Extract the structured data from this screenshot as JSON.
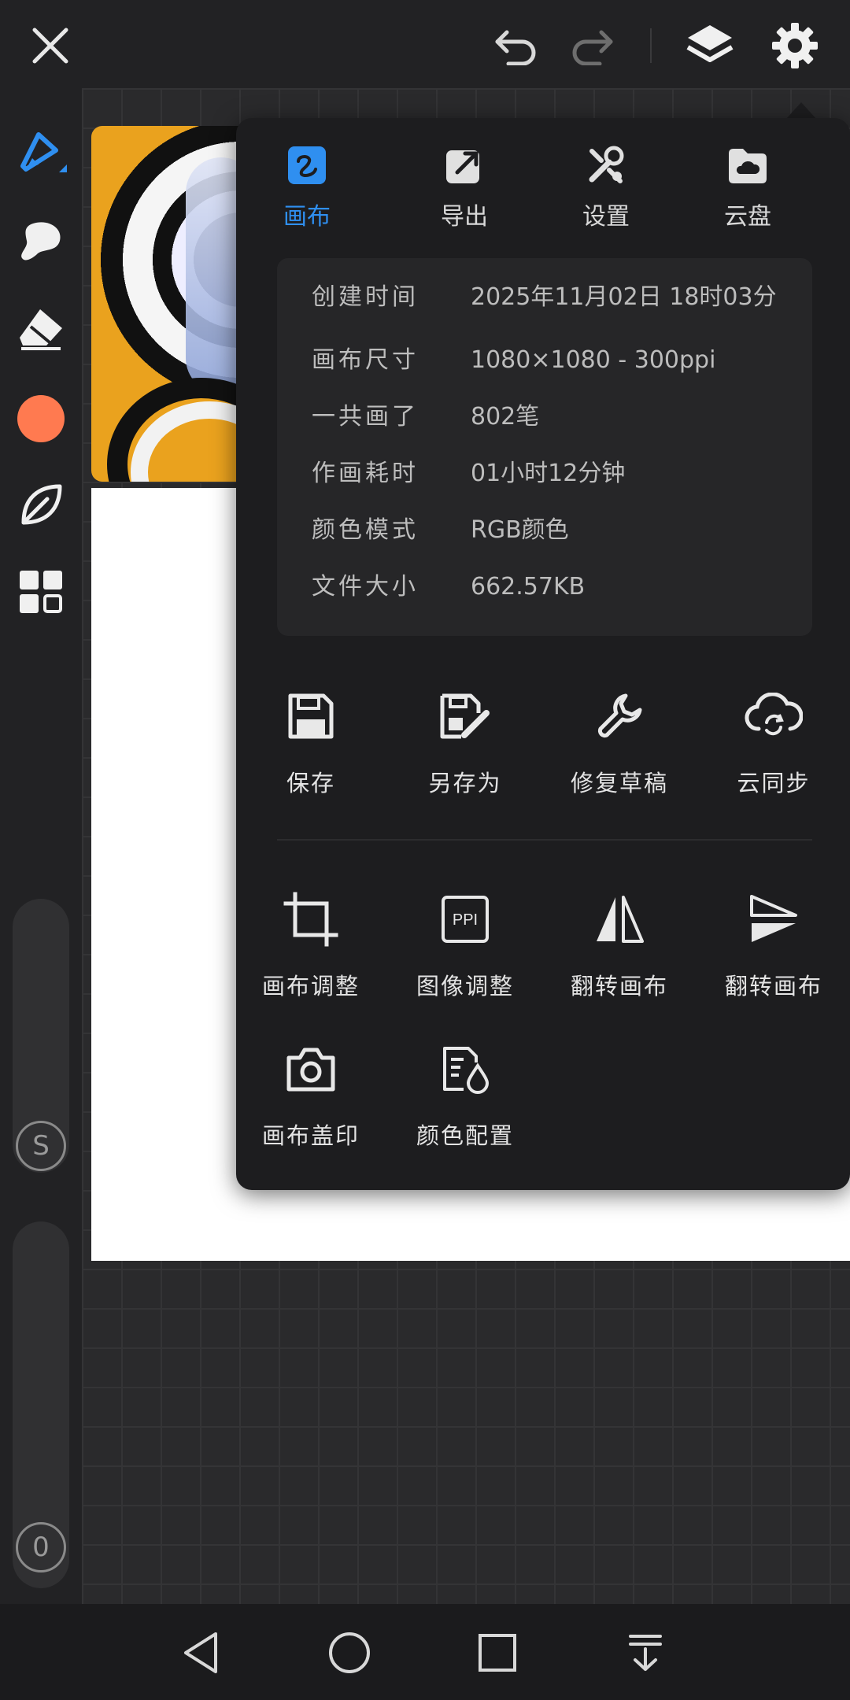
{
  "topbar": {
    "close_icon": "close-icon",
    "undo_icon": "undo-icon",
    "redo_icon": "redo-icon",
    "layers_icon": "layers-icon",
    "settings_icon": "gear-icon"
  },
  "sidebar": {
    "tools": [
      "pen-icon",
      "smudge-icon",
      "eraser-icon",
      "color-swatch",
      "leaf-icon",
      "grid-icon"
    ],
    "current_color": "#ff7a50",
    "size_slider_label": "S",
    "opacity_slider_label": "0"
  },
  "panel": {
    "tabs": [
      {
        "label": "画布",
        "active": true
      },
      {
        "label": "导出",
        "active": false
      },
      {
        "label": "设置",
        "active": false
      },
      {
        "label": "云盘",
        "active": false
      }
    ],
    "info": [
      {
        "key": "创建时间",
        "value": "2025年11月02日 18时03分"
      },
      {
        "key": "画布尺寸",
        "value": "1080×1080 - 300ppi"
      },
      {
        "key": "一共画了",
        "value": "802笔"
      },
      {
        "key": "作画耗时",
        "value": "01小时12分钟"
      },
      {
        "key": "颜色模式",
        "value": "RGB颜色"
      },
      {
        "key": "文件大小",
        "value": "662.57KB"
      }
    ],
    "actions": [
      {
        "label": "保存",
        "icon": "save-icon"
      },
      {
        "label": "另存为",
        "icon": "save-as-icon"
      },
      {
        "label": "修复草稿",
        "icon": "wrench-icon"
      },
      {
        "label": "云同步",
        "icon": "cloud-sync-icon"
      }
    ],
    "tools": [
      {
        "label": "画布调整",
        "icon": "crop-icon"
      },
      {
        "label": "图像调整",
        "icon": "ppi-icon",
        "icon_text": "PPI"
      },
      {
        "label": "翻转画布",
        "icon": "flip-horizontal-icon"
      },
      {
        "label": "翻转画布",
        "icon": "flip-vertical-icon"
      },
      {
        "label": "画布盖印",
        "icon": "camera-icon"
      },
      {
        "label": "颜色配置",
        "icon": "color-profile-icon"
      }
    ]
  },
  "colors": {
    "accent": "#2f8ff0",
    "panel_bg": "#1d1d1f",
    "info_bg": "#262628"
  }
}
